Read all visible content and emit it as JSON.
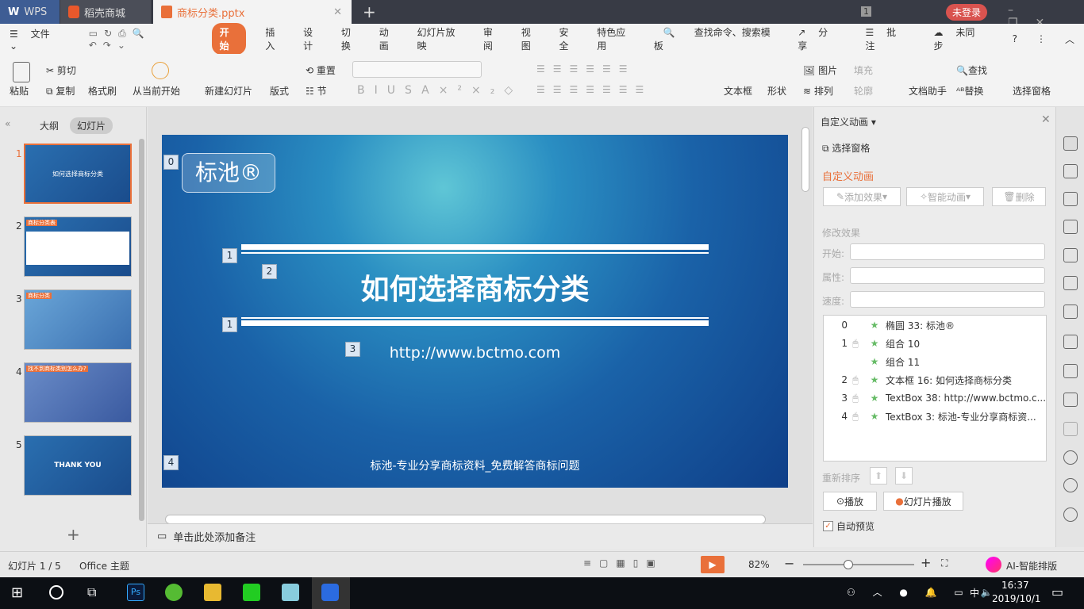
{
  "titlebar": {
    "tabs": [
      "WPS",
      "稻壳商城",
      "商标分类.pptx"
    ],
    "login": "未登录",
    "badge": "1"
  },
  "menu": {
    "file": "文件",
    "tabs": [
      "开始",
      "插入",
      "设计",
      "切换",
      "动画",
      "幻灯片放映",
      "审阅",
      "视图",
      "安全",
      "特色应用"
    ],
    "search": "查找命令、搜索模板",
    "share": "分享",
    "comment": "批注",
    "sync": "未同步"
  },
  "ribbon": {
    "paste": "粘贴",
    "cut": "剪切",
    "copy": "复制",
    "format_painter": "格式刷",
    "play_from_current": "从当前开始",
    "new_slide": "新建幻灯片",
    "layout": "版式",
    "reset": "重置",
    "section": "节",
    "textbox": "文本框",
    "shape": "形状",
    "picture": "图片",
    "fill": "填充",
    "arrange": "排列",
    "outline": "轮廓",
    "doc_assistant": "文档助手",
    "find": "查找",
    "replace": "替换",
    "selection_pane": "选择窗格"
  },
  "left": {
    "tabs": [
      "大纲",
      "幻灯片"
    ],
    "slides": [
      {
        "num": "1",
        "title": "如何选择商标分类"
      },
      {
        "num": "2",
        "title": "商标分类表"
      },
      {
        "num": "3",
        "title": "商标分类"
      },
      {
        "num": "4",
        "title": "找不到商标类别怎么办?"
      },
      {
        "num": "5",
        "title": "THANK YOU"
      }
    ]
  },
  "slide": {
    "logo": "标池®",
    "title": "如何选择商标分类",
    "url": "http://www.bctmo.com",
    "footer": "标池-专业分享商标资料_免费解答商标问题",
    "tags": [
      "0",
      "1",
      "2",
      "1",
      "3",
      "4"
    ]
  },
  "notes": {
    "placeholder": "单击此处添加备注"
  },
  "panel": {
    "header": "自定义动画",
    "selection_pane": "选择窗格",
    "section_title": "自定义动画",
    "add_effect": "添加效果",
    "smart_anim": "智能动画",
    "delete": "删除",
    "modify": "修改效果",
    "start": "开始:",
    "property": "属性:",
    "speed": "速度:",
    "items": [
      {
        "order": "0",
        "mouse": false,
        "name": "椭圆 33: 标池®"
      },
      {
        "order": "1",
        "mouse": true,
        "name": "组合 10"
      },
      {
        "order": "",
        "mouse": false,
        "name": "组合 11"
      },
      {
        "order": "2",
        "mouse": true,
        "name": "文本框 16: 如何选择商标分类"
      },
      {
        "order": "3",
        "mouse": true,
        "name": "TextBox 38: http://www.bctmo.c..."
      },
      {
        "order": "4",
        "mouse": true,
        "name": "TextBox 3: 标池-专业分享商标资..."
      }
    ],
    "reorder": "重新排序",
    "play": "播放",
    "slideshow": "幻灯片播放",
    "autopreview": "自动预览",
    "autopreview_checked": true
  },
  "status": {
    "slide": "幻灯片 1 / 5",
    "theme": "Office 主题",
    "zoom": "82%",
    "zoom_level": 0.41,
    "ai": "AI-智能排版"
  },
  "taskbar": {
    "time": "16:37",
    "date": "2019/10/1",
    "ime": "中"
  }
}
